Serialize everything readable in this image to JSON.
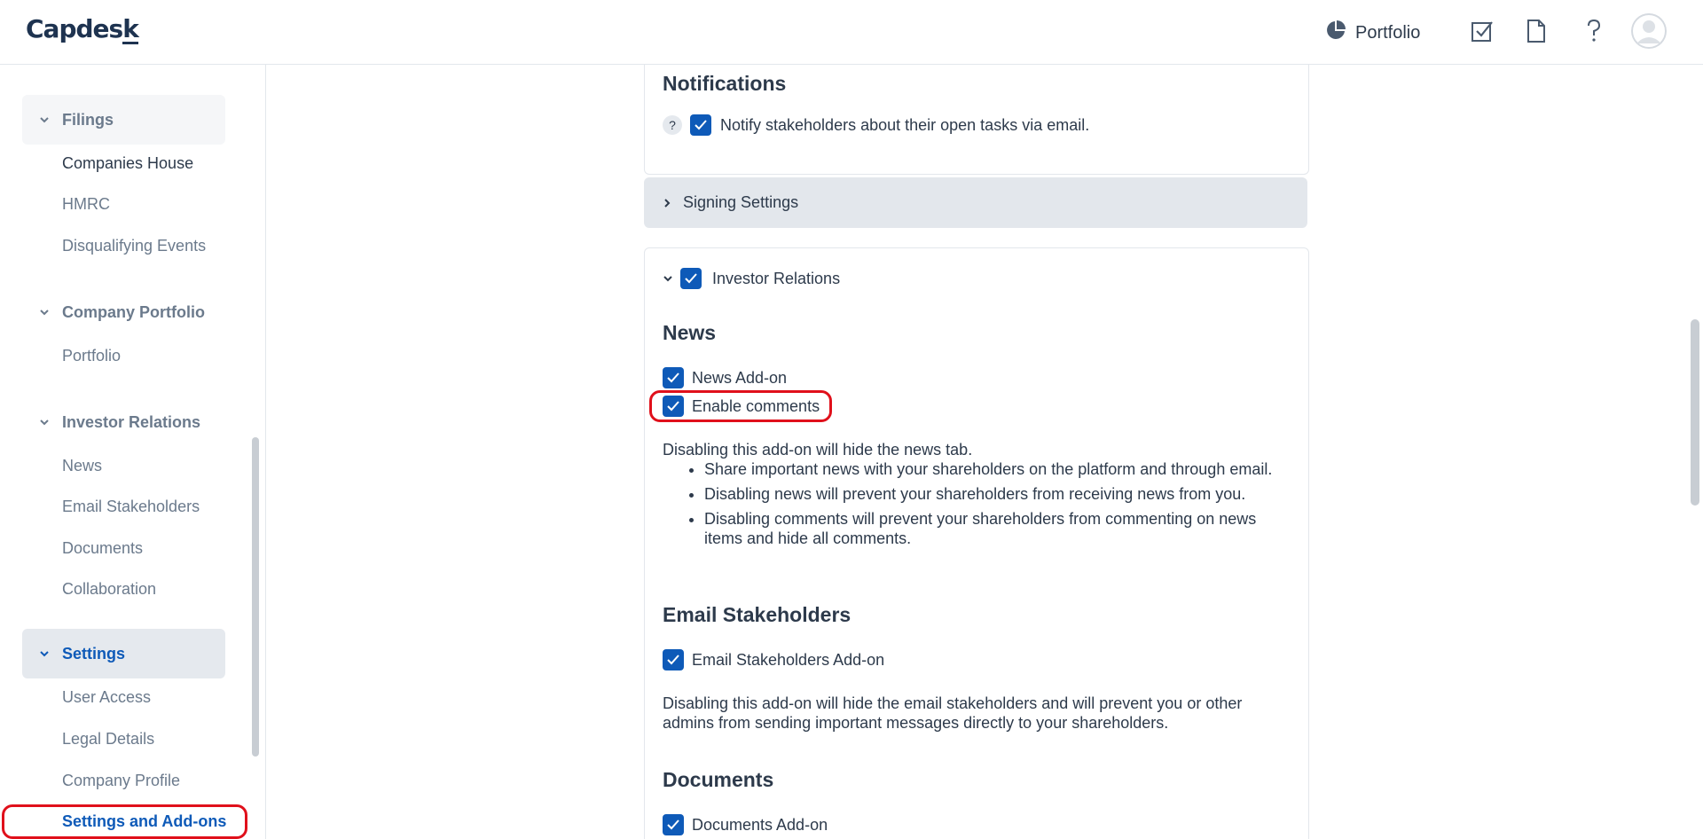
{
  "header": {
    "logo": "Capdesk",
    "portfolio_label": "Portfolio",
    "icons": [
      "pie-chart-icon",
      "tasks-check-icon",
      "document-icon",
      "help-icon",
      "user-avatar"
    ]
  },
  "sidebar": {
    "sections": [
      {
        "label": "Filings",
        "items": [
          "Companies House",
          "HMRC",
          "Disqualifying Events"
        ]
      },
      {
        "label": "Company Portfolio",
        "items": [
          "Portfolio"
        ]
      },
      {
        "label": "Investor Relations",
        "items": [
          "News",
          "Email Stakeholders",
          "Documents",
          "Collaboration"
        ]
      },
      {
        "label": "Settings",
        "items": [
          "User Access",
          "Legal Details",
          "Company Profile",
          "Settings and Add-ons"
        ]
      }
    ],
    "active_section": "Settings",
    "active_item": "Settings and Add-ons"
  },
  "notifications": {
    "title": "Notifications",
    "help": "?",
    "notify_label": "Notify stakeholders about their open tasks via email."
  },
  "signing": {
    "label": "Signing Settings"
  },
  "investor_relations": {
    "label": "Investor Relations",
    "news": {
      "title": "News",
      "addon_label": "News Add-on",
      "comments_label": "Enable comments",
      "description": "Disabling this add-on will hide the news tab.",
      "bullets": [
        "Share important news with your shareholders on the platform and through email.",
        "Disabling news will prevent your shareholders from receiving news from you.",
        "Disabling comments will prevent your shareholders from commenting on news items and hide all comments."
      ]
    },
    "email": {
      "title": "Email Stakeholders",
      "addon_label": "Email Stakeholders Add-on",
      "description": "Disabling this add-on will hide the email stakeholders and will prevent you or other admins from sending important messages directly to your shareholders."
    },
    "documents": {
      "title": "Documents",
      "addon_label": "Documents Add-on"
    }
  },
  "colors": {
    "accent": "#0e5ab8",
    "highlight": "#e0101b",
    "text": "#2d3a4b",
    "muted": "#6b7a8c"
  }
}
